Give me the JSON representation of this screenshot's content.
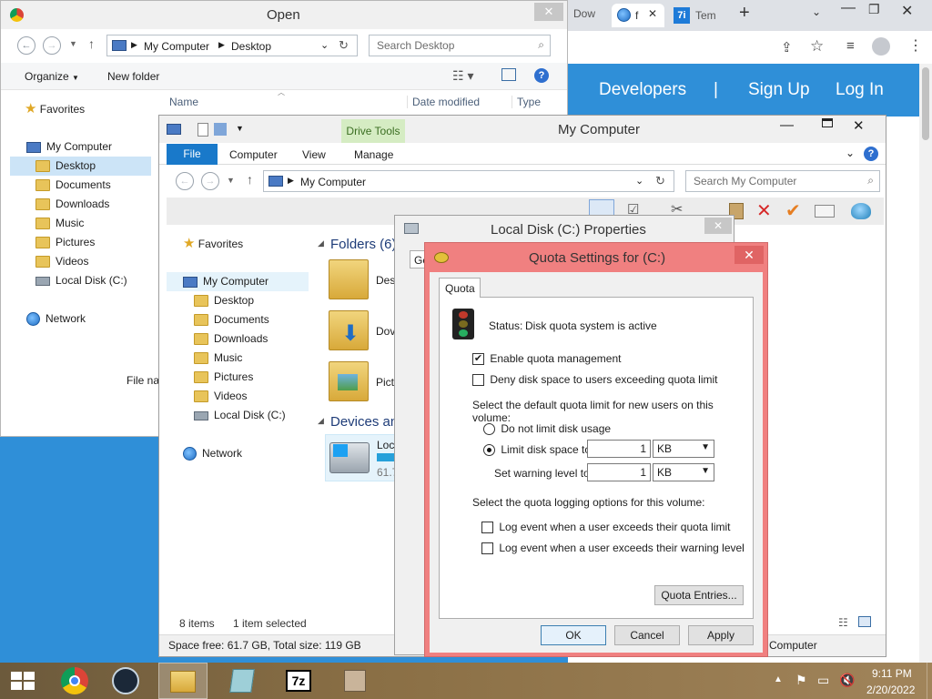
{
  "browser": {
    "tabs": [
      "Dow",
      "f",
      ""
    ],
    "tab2_badge": "7i",
    "tab3_label": "Tem",
    "banner_links": [
      "Developers",
      "|",
      "Sign Up",
      "Log In"
    ],
    "colors": {
      "banner": "#2f8fd8"
    }
  },
  "open_dialog": {
    "title": "Open",
    "breadcrumb": [
      "My Computer",
      "Desktop"
    ],
    "search_placeholder": "Search Desktop",
    "organize_label": "Organize",
    "new_folder_label": "New folder",
    "columns": [
      "Name",
      "Date modified",
      "Type"
    ],
    "nav": {
      "favorites": "Favorites",
      "my_computer": "My Computer",
      "items": [
        "Desktop",
        "Documents",
        "Downloads",
        "Music",
        "Pictures",
        "Videos",
        "Local Disk (C:)"
      ],
      "network": "Network"
    },
    "file_name_label": "File na"
  },
  "explorer": {
    "title": "My Computer",
    "drive_tools": "Drive Tools",
    "tabs": [
      "File",
      "Computer",
      "View",
      "Manage"
    ],
    "address": "My Computer",
    "search_placeholder": "Search My Computer",
    "nav": {
      "favorites": "Favorites",
      "my_computer": "My Computer",
      "items": [
        "Desktop",
        "Documents",
        "Downloads",
        "Music",
        "Pictures",
        "Videos",
        "Local Disk (C:)"
      ],
      "network": "Network"
    },
    "folders_header": "Folders (6)",
    "folder_labels": [
      "Des",
      "Dov",
      "Pict"
    ],
    "devices_header": "Devices an",
    "device_name": "Loc",
    "device_size": "61.7",
    "status_items": "8 items",
    "status_selected": "1 item selected",
    "status_bar": "Space free: 61.7 GB, Total size: 119 GB",
    "status_right": "Computer"
  },
  "properties": {
    "title": "Local Disk (C:) Properties",
    "tab_fragment": "Ge"
  },
  "quota": {
    "title": "Quota Settings for  (C:)",
    "tab": "Quota",
    "status_label": "Status:",
    "status_value": "Disk quota system is active",
    "enable_label": "Enable quota management",
    "enable_checked": true,
    "deny_label": "Deny disk space to users exceeding quota limit",
    "deny_checked": false,
    "default_limit_heading": "Select the default quota limit for new users on this volume:",
    "no_limit_label": "Do not limit disk usage",
    "limit_label": "Limit disk space to",
    "limit_value": "1",
    "limit_unit": "KB",
    "warning_label": "Set warning level to",
    "warning_value": "1",
    "warning_unit": "KB",
    "logging_heading": "Select the quota logging options for this volume:",
    "log_limit_label": "Log event when a user exceeds their quota limit",
    "log_warning_label": "Log event when a user exceeds their warning level",
    "entries_button": "Quota Entries...",
    "ok": "OK",
    "cancel": "Cancel",
    "apply": "Apply",
    "colors": {
      "frame": "#f08080",
      "titlebar": "#f08080"
    }
  },
  "taskbar": {
    "time": "9:11 PM",
    "date": "2/20/2022",
    "seven_zip": "7z"
  }
}
